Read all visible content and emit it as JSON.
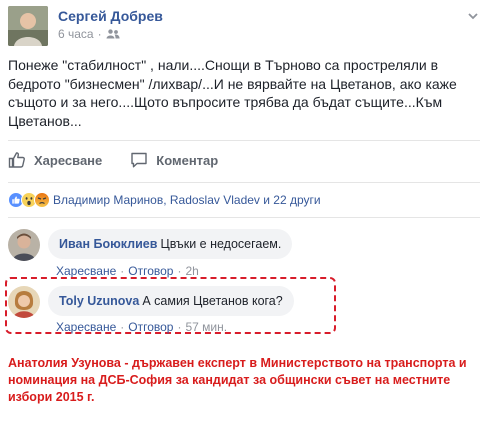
{
  "post": {
    "author": "Сергей Добрев",
    "time": "6 часа",
    "text": "Понеже \"стабилност\" , нали....Снощи в Търново са простреляли в бедрото \"бизнесмен\" /лихвар/...И не вярвайте на Цветанов, ако каже същото и за него....Щото въпросите трябва да бъдат същите...Към Цветанов...",
    "icons": {
      "privacy": "friends-icon",
      "menu": "chevron-down-icon"
    }
  },
  "actions": {
    "like_label": "Харесване",
    "comment_label": "Коментар"
  },
  "reactions": {
    "summary": "Владимир Маринов, Radoslav Vladev и 22 други",
    "icons": [
      "like-reaction",
      "wow-reaction",
      "angry-reaction"
    ]
  },
  "comments": [
    {
      "name": "Иван Боюклиев",
      "text": "Цвъки е недосегаем.",
      "like": "Харесване",
      "reply": "Отговор",
      "time": "2h"
    },
    {
      "name": "Toly Uzunova",
      "text": "А самия Цветанов кога?",
      "like": "Харесване",
      "reply": "Отговор",
      "time": "57 мин."
    }
  ],
  "caption": "Анатолия Узунова - държавен експерт в Министерството на транспорта и номинация на ДСБ-София за кандидат за общински съвет на местните избори 2015 г.",
  "colors": {
    "link": "#365899",
    "highlight": "#d81c2a",
    "caption": "#d81c1c"
  }
}
